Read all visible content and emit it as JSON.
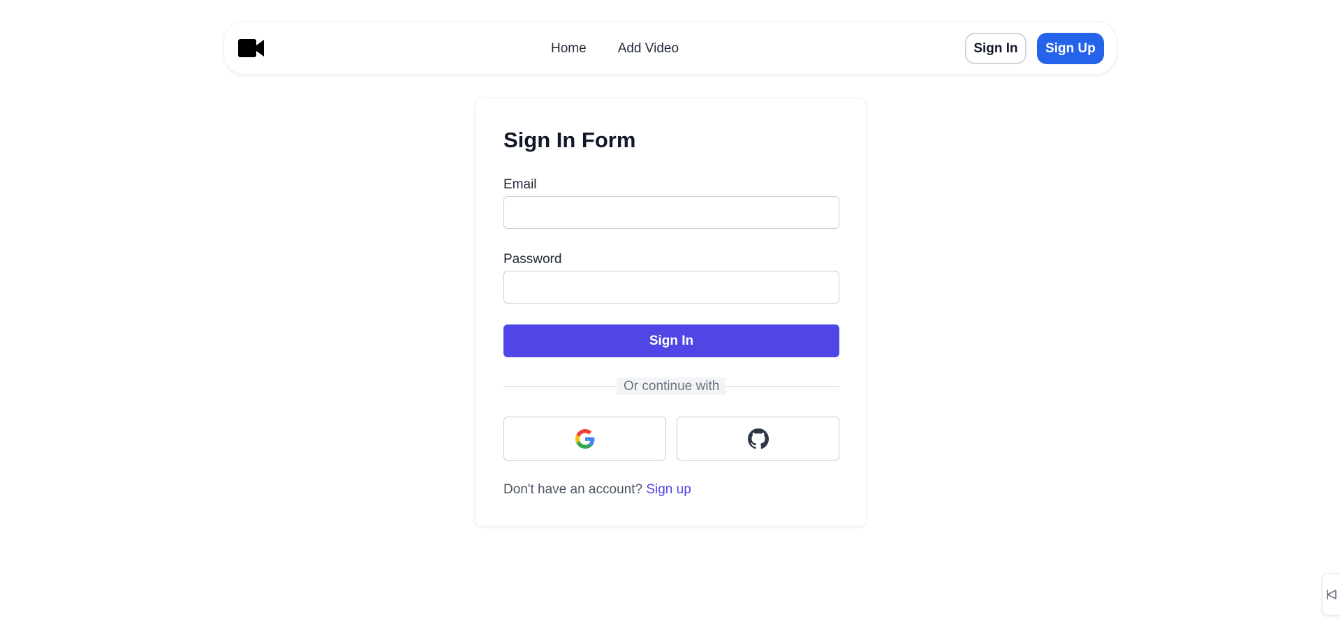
{
  "navbar": {
    "logo_icon": "video-camera-icon",
    "links": [
      "Home",
      "Add Video"
    ],
    "signin_label": "Sign In",
    "signup_label": "Sign Up"
  },
  "form": {
    "title": "Sign In Form",
    "email_label": "Email",
    "email_value": "",
    "password_label": "Password",
    "password_value": "",
    "submit_label": "Sign In",
    "divider_text": "Or continue with",
    "social": [
      "google-icon",
      "github-icon"
    ],
    "footer_text": "Don't have an account?",
    "footer_link": "Sign up"
  },
  "colors": {
    "primary": "#4f46e5",
    "nav_signup": "#2563eb"
  }
}
